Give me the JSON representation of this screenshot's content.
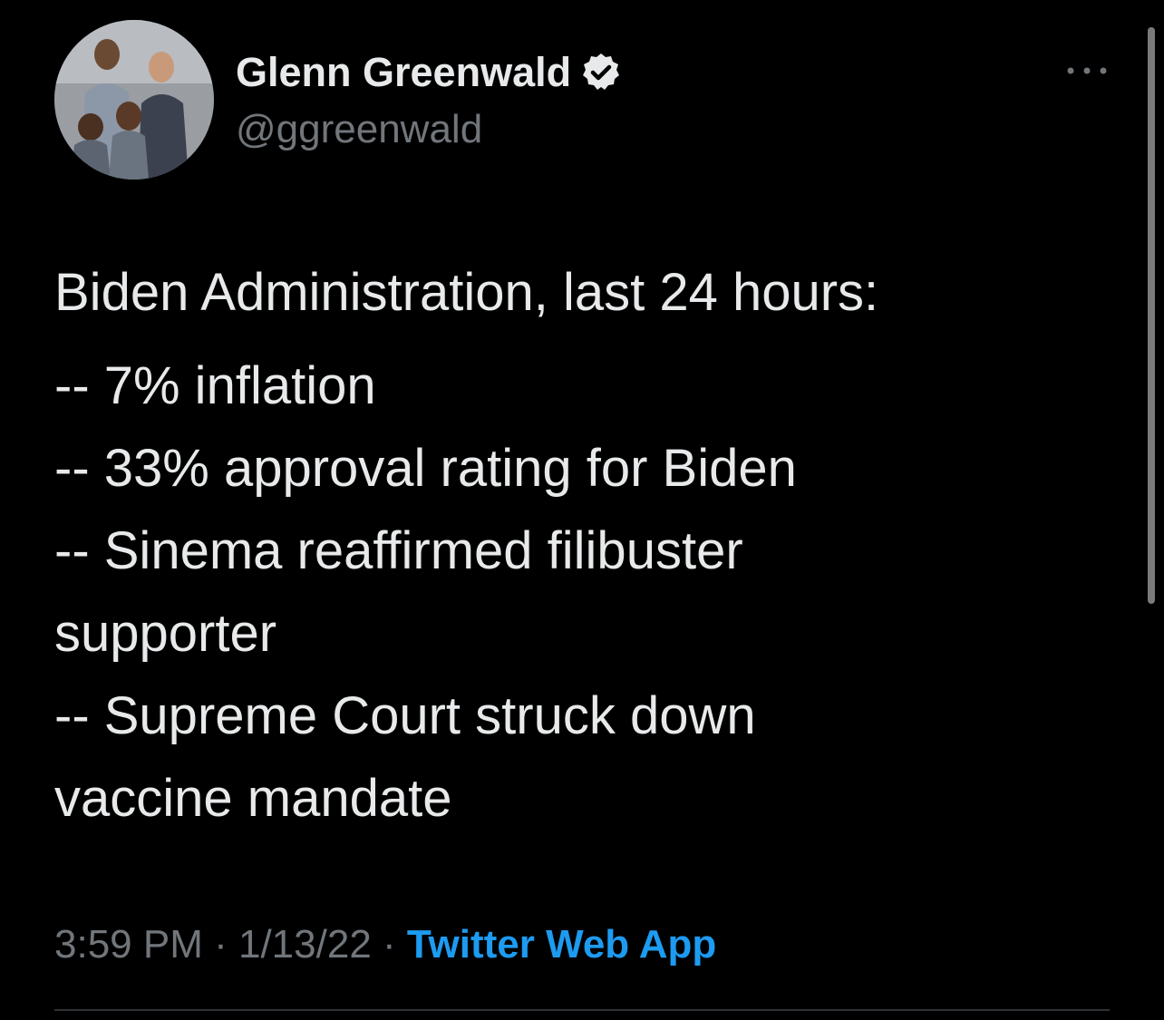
{
  "author": {
    "display_name": "Glenn Greenwald",
    "handle": "@ggreenwald",
    "verified": true,
    "avatar_icon": "profile-photo"
  },
  "tweet": {
    "lines": [
      "Biden Administration, last 24 hours:",
      "-- 7% inflation",
      "-- 33% approval rating for Biden",
      "-- Sinema reaffirmed filibuster",
      "supporter",
      "-- Supreme Court struck down",
      "vaccine mandate"
    ]
  },
  "meta": {
    "time": "3:59 PM",
    "separator": " · ",
    "date": "1/13/22",
    "source": "Twitter Web App"
  },
  "colors": {
    "background": "#000000",
    "primary_text": "#e7e9ea",
    "secondary_text": "#71767b",
    "link": "#1d9bf0"
  },
  "icons": {
    "more": "more-horizontal-icon",
    "verified": "verified-badge-icon"
  }
}
